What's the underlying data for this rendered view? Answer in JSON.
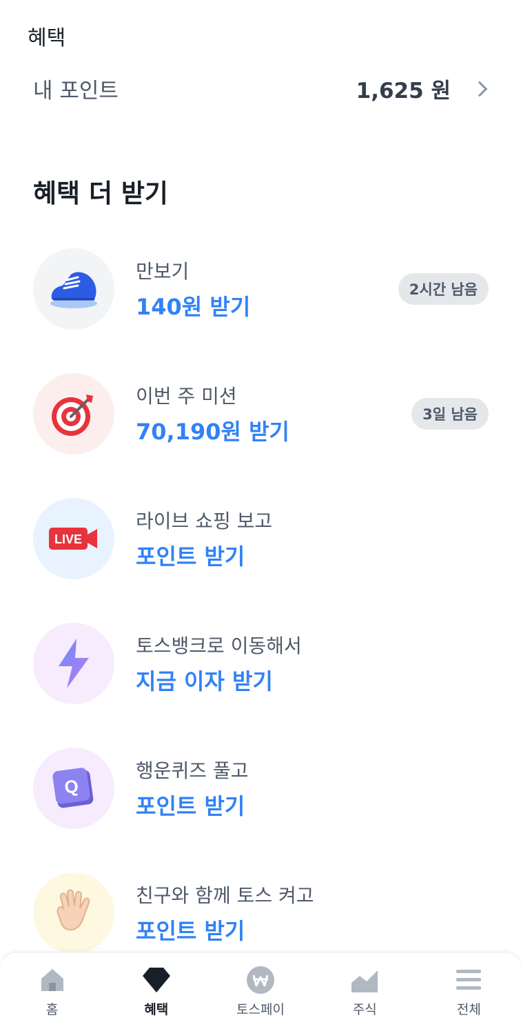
{
  "header": {
    "title": "혜택"
  },
  "points": {
    "label": "내 포인트",
    "value": "1,625 원"
  },
  "section": {
    "title": "혜택 더 받기"
  },
  "benefits": [
    {
      "title": "만보기",
      "reward": "140원 받기",
      "badge": "2시간 남음",
      "icon": "sneaker-icon",
      "icon_bg": "#f2f4f6"
    },
    {
      "title": "이번 주 미션",
      "reward": "70,190원 받기",
      "badge": "3일 남음",
      "icon": "dart-target-icon",
      "icon_bg": "#fdeeee"
    },
    {
      "title": "라이브 쇼핑 보고",
      "reward": "포인트 받기",
      "icon": "live-camera-icon",
      "icon_bg": "#e8f3ff"
    },
    {
      "title": "토스뱅크로 이동해서",
      "reward": "지금 이자 받기",
      "icon": "lightning-icon",
      "icon_bg": "#f6ecfd"
    },
    {
      "title": "행운퀴즈 풀고",
      "reward": "포인트 받기",
      "icon": "quiz-cube-icon",
      "icon_bg": "#f6ecfd"
    },
    {
      "title": "친구와 함께 토스 켜고",
      "reward": "포인트 받기",
      "icon": "waving-hand-icon",
      "icon_bg": "#fff8e1"
    }
  ],
  "nav": {
    "items": [
      {
        "label": "홈",
        "icon": "home-icon"
      },
      {
        "label": "혜택",
        "icon": "gem-icon",
        "active": true
      },
      {
        "label": "토스페이",
        "icon": "won-coin-icon"
      },
      {
        "label": "주식",
        "icon": "stock-chart-icon"
      },
      {
        "label": "전체",
        "icon": "menu-icon"
      }
    ]
  },
  "colors": {
    "accent": "#3182f6",
    "text_primary": "#191f28",
    "text_secondary": "#4e5968",
    "badge_bg": "#e5e8eb"
  }
}
